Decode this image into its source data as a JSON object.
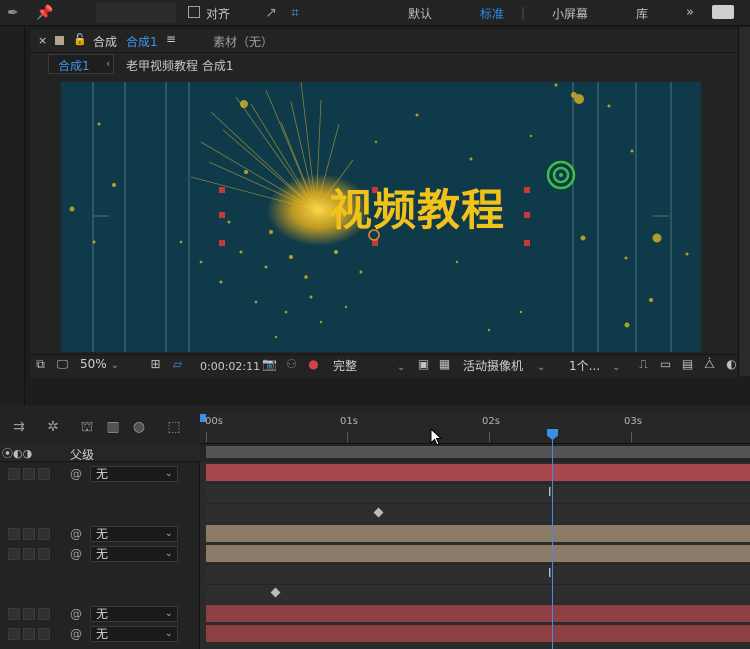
{
  "toolbar": {
    "snap_label": "对齐",
    "workspaces": [
      "默认",
      "标准",
      "小屏幕",
      "库"
    ],
    "active_workspace": "标准",
    "more": "»"
  },
  "comp": {
    "tab_label": "合成",
    "tab_name": "合成1",
    "footage_label": "素材（无）",
    "breadcrumb_current": "合成1",
    "breadcrumb_parent": "老甲视频教程 合成1",
    "overlay_text": "视频教程"
  },
  "viewer_controls": {
    "zoom": "50%",
    "timecode": "0:00:02:11",
    "resolution": "完整",
    "camera": "活动摄像机",
    "views": "1个..."
  },
  "timeline": {
    "parent_header": "父级",
    "ticks": [
      "00s",
      "01s",
      "02s",
      "03s"
    ],
    "layers": [
      {
        "parent": "无"
      },
      {
        "parent": "无"
      },
      {
        "parent": "无"
      },
      {
        "parent": "无"
      },
      {
        "parent": "无"
      }
    ]
  },
  "colors": {
    "accent": "#2d8ceb",
    "text_yellow": "#f2c21b",
    "viewer_bg": "#0f3a4a",
    "layer_red": "#a8474d",
    "layer_tan": "#8b7a67"
  }
}
